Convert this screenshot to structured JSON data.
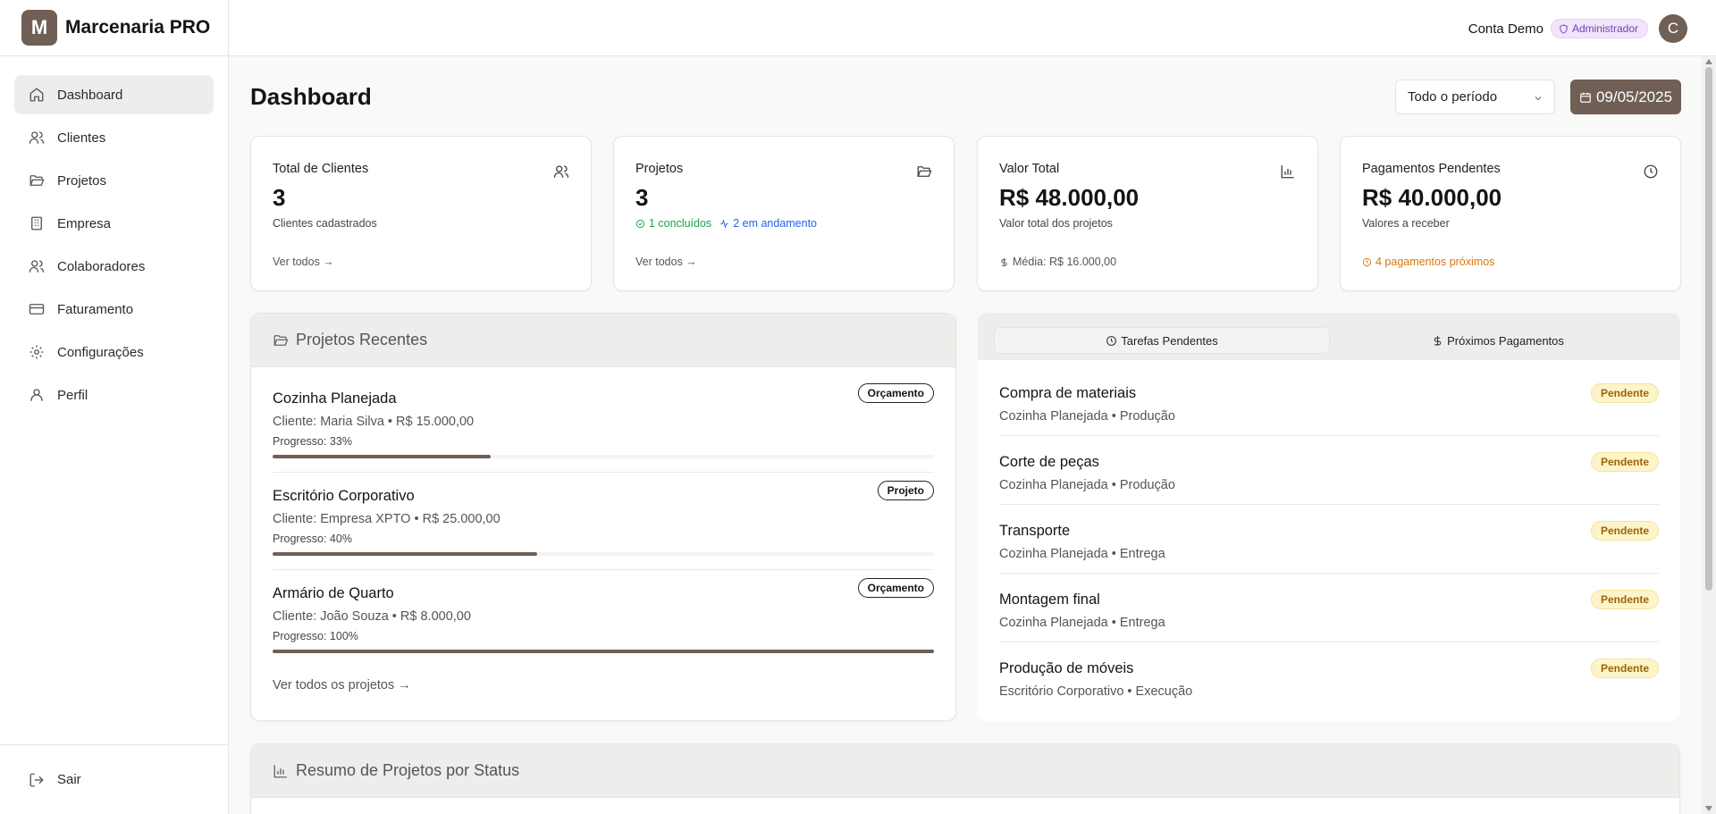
{
  "brand": {
    "logo_letter": "M",
    "name": "Marcenaria PRO"
  },
  "sidebar": {
    "items": [
      {
        "label": "Dashboard",
        "icon": "home-icon",
        "active": true
      },
      {
        "label": "Clientes",
        "icon": "users-icon"
      },
      {
        "label": "Projetos",
        "icon": "folder-icon"
      },
      {
        "label": "Empresa",
        "icon": "building-icon"
      },
      {
        "label": "Colaboradores",
        "icon": "users-icon"
      },
      {
        "label": "Faturamento",
        "icon": "credit-card-icon"
      },
      {
        "label": "Configurações",
        "icon": "gear-icon"
      },
      {
        "label": "Perfil",
        "icon": "user-icon"
      }
    ],
    "logout_label": "Sair"
  },
  "header": {
    "account_name": "Conta Demo",
    "role": "Administrador",
    "avatar_letter": "C"
  },
  "main": {
    "title": "Dashboard",
    "period": "Todo o período",
    "date": "09/05/2025"
  },
  "stats": {
    "clients": {
      "title": "Total de Clientes",
      "value": "3",
      "sub": "Clientes cadastrados",
      "link": "Ver todos →"
    },
    "projects": {
      "title": "Projetos",
      "value": "3",
      "done": "1 concluídos",
      "ongoing": "2 em andamento",
      "link": "Ver todos →"
    },
    "total": {
      "title": "Valor Total",
      "value": "R$ 48.000,00",
      "sub": "Valor total dos projetos",
      "foot": "Média: R$ 16.000,00"
    },
    "pending": {
      "title": "Pagamentos Pendentes",
      "value": "R$ 40.000,00",
      "sub": "Valores a receber",
      "foot": "4 pagamentos próximos"
    }
  },
  "recent": {
    "title": "Projetos Recentes",
    "items": [
      {
        "name": "Cozinha Planejada",
        "client": "Cliente: Maria Silva • R$ 15.000,00",
        "progress_label": "Progresso: 33%",
        "progress": 33,
        "badge": "Orçamento"
      },
      {
        "name": "Escritório Corporativo",
        "client": "Cliente: Empresa XPTO • R$ 25.000,00",
        "progress_label": "Progresso: 40%",
        "progress": 40,
        "badge": "Projeto"
      },
      {
        "name": "Armário de Quarto",
        "client": "Cliente: João Souza • R$ 8.000,00",
        "progress_label": "Progresso: 100%",
        "progress": 100,
        "badge": "Orçamento"
      }
    ],
    "all_link": "Ver todos os projetos →"
  },
  "tasks": {
    "tabs": [
      "Tarefas Pendentes",
      "Próximos Pagamentos"
    ],
    "items": [
      {
        "name": "Compra de materiais",
        "meta": "Cozinha Planejada • Produção",
        "status": "Pendente"
      },
      {
        "name": "Corte de peças",
        "meta": "Cozinha Planejada • Produção",
        "status": "Pendente"
      },
      {
        "name": "Transporte",
        "meta": "Cozinha Planejada • Entrega",
        "status": "Pendente"
      },
      {
        "name": "Montagem final",
        "meta": "Cozinha Planejada • Entrega",
        "status": "Pendente"
      },
      {
        "name": "Produção de móveis",
        "meta": "Escritório Corporativo • Execução",
        "status": "Pendente"
      }
    ]
  },
  "summary": {
    "title": "Resumo de Projetos por Status"
  },
  "colors": {
    "brand": "#6f5f55",
    "pending_bg": "#fdf5c9",
    "role_bg": "#f1e4fb"
  }
}
